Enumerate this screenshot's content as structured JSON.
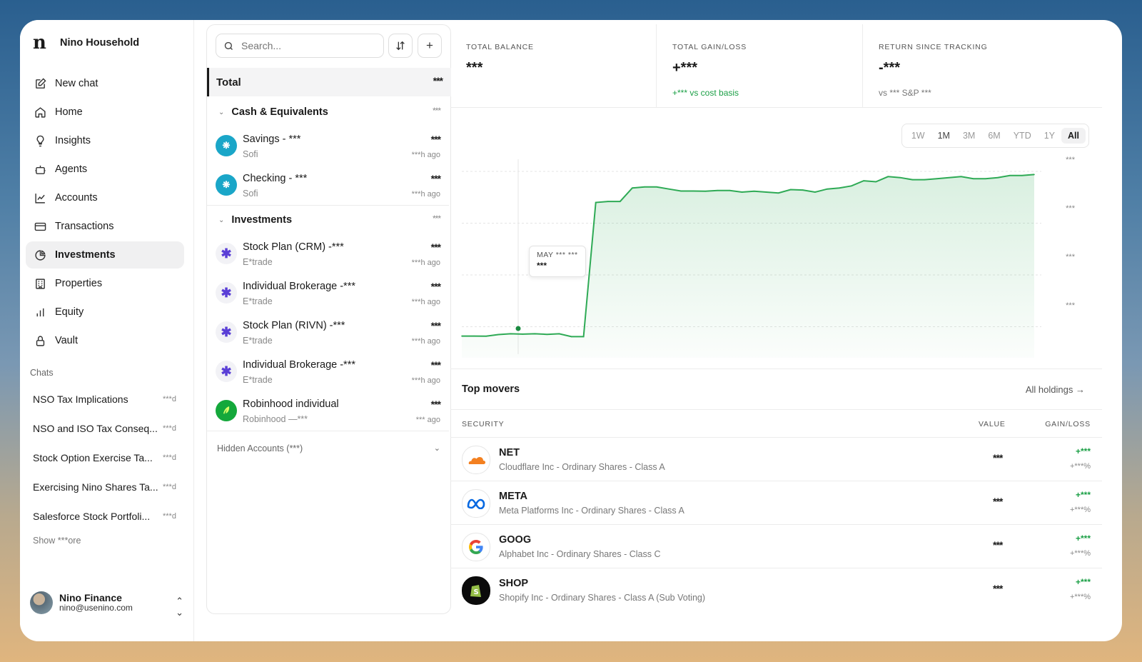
{
  "sidebar": {
    "brand": "Nino Household",
    "nav": [
      {
        "label": "New chat",
        "icon": "edit-icon"
      },
      {
        "label": "Home",
        "icon": "home-icon"
      },
      {
        "label": "Insights",
        "icon": "lightbulb-icon"
      },
      {
        "label": "Agents",
        "icon": "robot-icon"
      },
      {
        "label": "Accounts",
        "icon": "line-chart-icon"
      },
      {
        "label": "Transactions",
        "icon": "card-icon"
      },
      {
        "label": "Investments",
        "icon": "pie-icon",
        "active": true
      },
      {
        "label": "Properties",
        "icon": "building-icon"
      },
      {
        "label": "Equity",
        "icon": "bar-chart-icon"
      },
      {
        "label": "Vault",
        "icon": "lock-icon"
      }
    ],
    "chats_heading": "Chats",
    "chats": [
      {
        "title": "NSO Tax Implications",
        "time": "***d"
      },
      {
        "title": "NSO and ISO Tax Conseq...",
        "time": "***d"
      },
      {
        "title": "Stock Option Exercise Ta...",
        "time": "***d"
      },
      {
        "title": "Exercising Nino Shares Ta...",
        "time": "***d"
      },
      {
        "title": "Salesforce Stock Portfoli...",
        "time": "***d"
      }
    ],
    "show_more": "Show ***ore",
    "user": {
      "name": "Nino Finance",
      "email": "nino@usenino.com"
    }
  },
  "accounts": {
    "search_placeholder": "Search...",
    "total_label": "Total",
    "total_value": "***",
    "cash_section": {
      "label": "Cash & Equivalents",
      "value": "***"
    },
    "cash_items": [
      {
        "name": "Savings - ***",
        "institution": "Sofi",
        "value": "***",
        "time": "***h ago"
      },
      {
        "name": "Checking - ***",
        "institution": "Sofi",
        "value": "***",
        "time": "***h ago"
      }
    ],
    "investments_section": {
      "label": "Investments",
      "value": "***"
    },
    "investment_items": [
      {
        "name": "Stock Plan (CRM) -***",
        "institution": "E*trade",
        "value": "***",
        "time": "***h ago"
      },
      {
        "name": "Individual Brokerage -***",
        "institution": "E*trade",
        "value": "***",
        "time": "***h ago"
      },
      {
        "name": "Stock Plan (RIVN) -***",
        "institution": "E*trade",
        "value": "***",
        "time": "***h ago"
      },
      {
        "name": "Individual Brokerage -***",
        "institution": "E*trade",
        "value": "***",
        "time": "***h ago"
      },
      {
        "name": "Robinhood individual",
        "institution": "Robinhood —***",
        "value": "***",
        "time": "*** ago"
      }
    ],
    "hidden_accounts": "Hidden Accounts (***)"
  },
  "stats": [
    {
      "label": "TOTAL BALANCE",
      "value": "***",
      "sub": ""
    },
    {
      "label": "TOTAL GAIN/LOSS",
      "value": "+***",
      "sub": "+*** vs cost basis"
    },
    {
      "label": "RETURN SINCE TRACKING",
      "value": "-***",
      "sub": "vs *** S&P ***"
    }
  ],
  "chart": {
    "ranges": [
      "1W",
      "1M",
      "3M",
      "6M",
      "YTD",
      "1Y",
      "All"
    ],
    "active_range": "All",
    "y_labels": [
      "***",
      "***",
      "***",
      "***"
    ],
    "tooltip": {
      "date": "MAY *** ***",
      "value": "***"
    },
    "line_color": "#2eaa55"
  },
  "chart_data": {
    "type": "area",
    "title": "",
    "xlabel": "",
    "ylabel": "",
    "x_index": [
      0,
      1,
      2,
      3,
      4,
      5,
      6,
      7,
      8,
      9,
      10,
      11,
      12,
      13,
      14,
      15,
      16,
      17,
      18,
      19,
      20,
      21,
      22,
      23,
      24,
      25,
      26,
      27,
      28,
      29,
      30,
      31,
      32,
      33,
      34,
      35,
      36,
      37,
      38,
      39,
      40,
      41,
      42,
      43,
      44,
      45,
      46,
      47
    ],
    "values": [
      10.5,
      10.5,
      10.4,
      11.2,
      11.6,
      11.4,
      11.6,
      11.3,
      11.6,
      10.2,
      10.2,
      75,
      75.5,
      75.5,
      82,
      82.5,
      82.5,
      81.5,
      80.5,
      80.5,
      80.4,
      80.8,
      80.8,
      80,
      80.4,
      80,
      79.6,
      81.2,
      81,
      80,
      81.5,
      82,
      83,
      85.5,
      85,
      87.5,
      87,
      86,
      86,
      86.5,
      87,
      87.5,
      86.5,
      86.5,
      87,
      88,
      88,
      88.5
    ],
    "ylim": [
      0,
      100
    ],
    "grid": true,
    "legend": "none"
  },
  "movers": {
    "title": "Top movers",
    "all_holdings": "All holdings",
    "columns": {
      "security": "SECURITY",
      "value": "VALUE",
      "gain": "GAIN/LOSS"
    },
    "rows": [
      {
        "ticker": "NET",
        "name": "Cloudflare Inc - Ordinary Shares - Class A",
        "value": "***",
        "gain": "+***",
        "pct": "+***%",
        "logo": "cloudflare-icon"
      },
      {
        "ticker": "META",
        "name": "Meta Platforms Inc - Ordinary Shares - Class A",
        "value": "***",
        "gain": "+***",
        "pct": "+***%",
        "logo": "meta-icon"
      },
      {
        "ticker": "GOOG",
        "name": "Alphabet Inc - Ordinary Shares - Class C",
        "value": "***",
        "gain": "+***",
        "pct": "+***%",
        "logo": "google-icon"
      },
      {
        "ticker": "SHOP",
        "name": "Shopify Inc - Ordinary Shares - Class A (Sub Voting)",
        "value": "***",
        "gain": "+***",
        "pct": "+***%",
        "logo": "shopify-icon"
      }
    ]
  }
}
